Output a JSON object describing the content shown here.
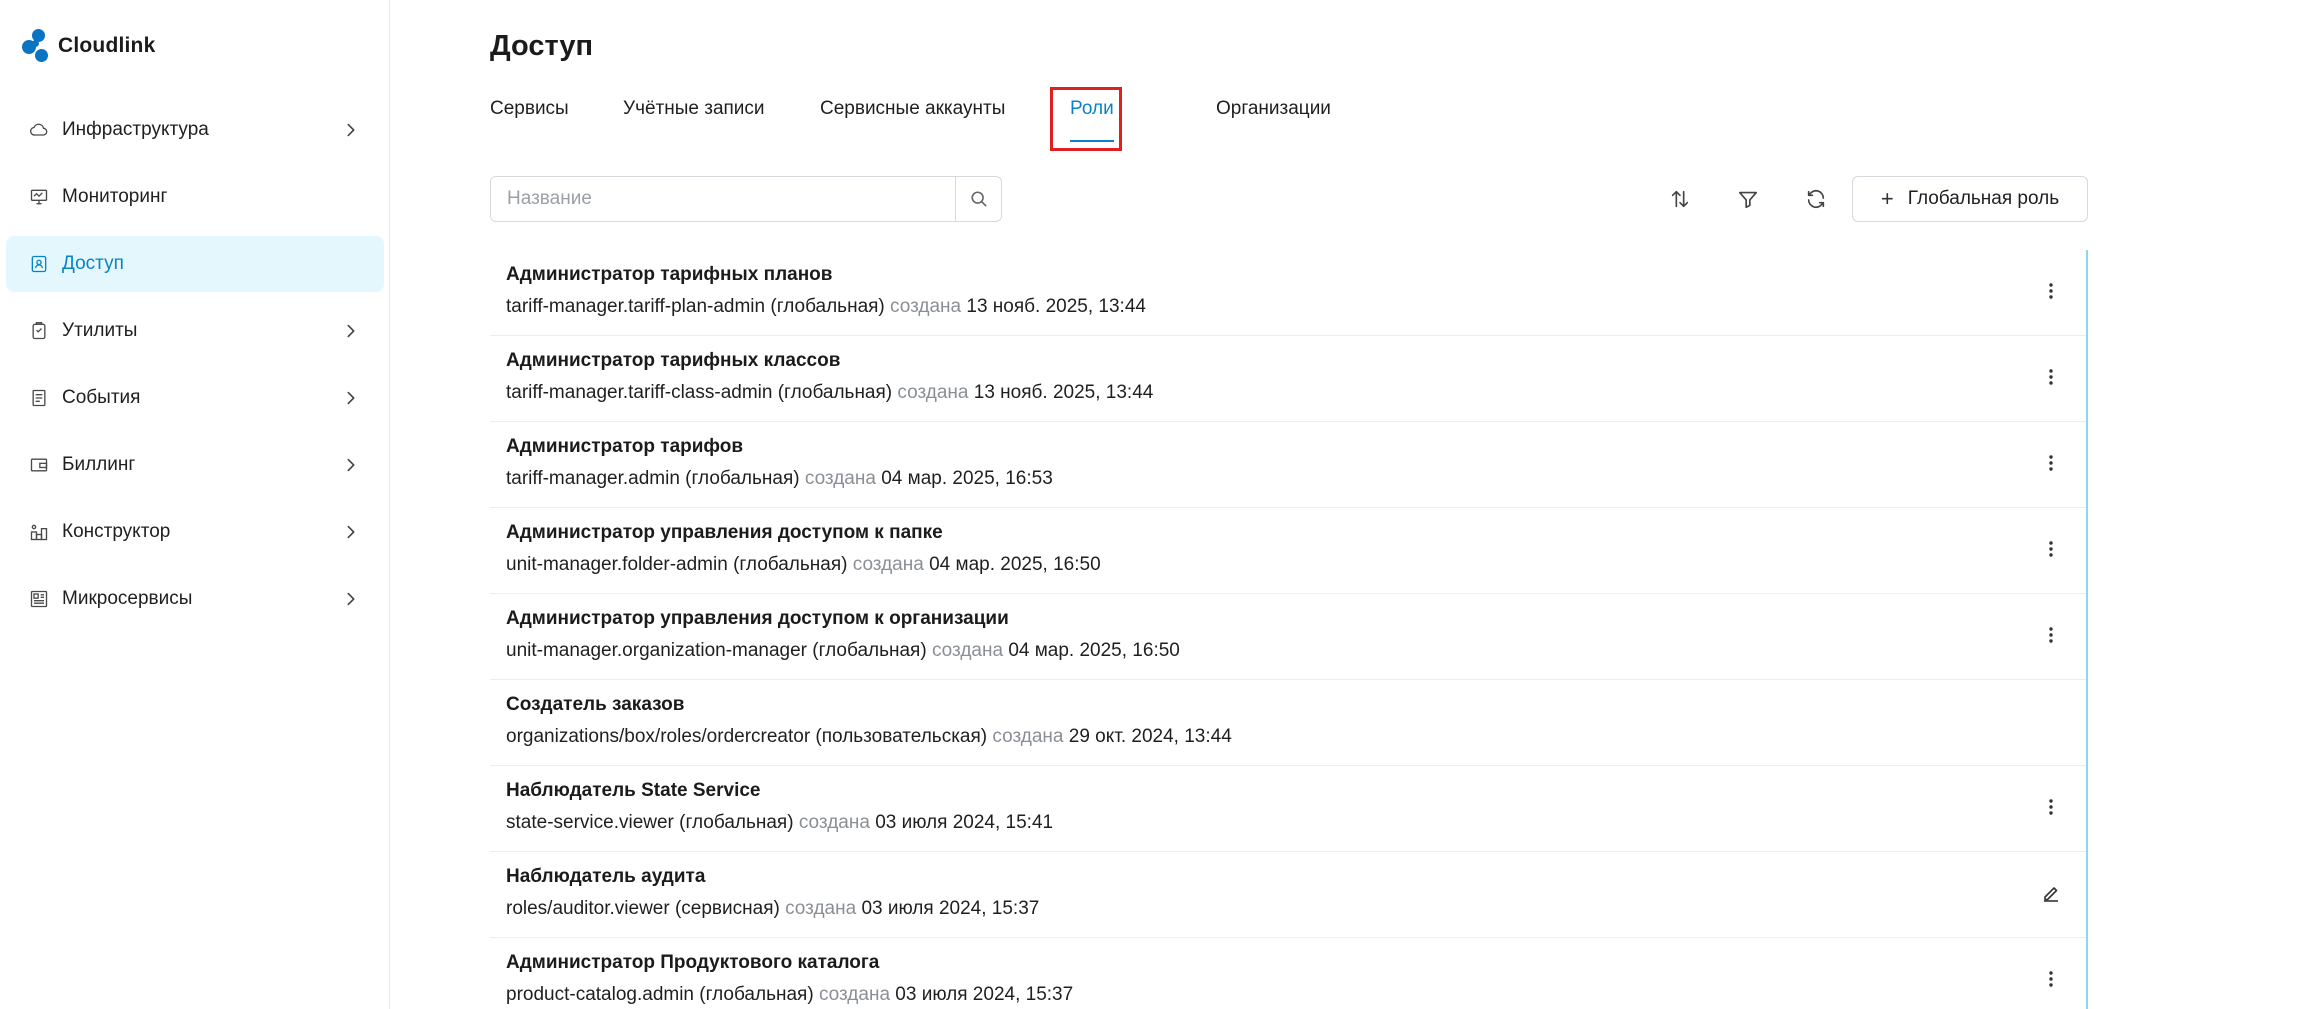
{
  "app": {
    "name": "Cloudlink"
  },
  "sidebar": {
    "items": [
      {
        "label": "Инфраструктура",
        "icon": "cloud-icon",
        "chevron": true,
        "active": false
      },
      {
        "label": "Мониторинг",
        "icon": "monitor-icon",
        "chevron": false,
        "active": false
      },
      {
        "label": "Доступ",
        "icon": "access-icon",
        "chevron": false,
        "active": true
      },
      {
        "label": "Утилиты",
        "icon": "tools-icon",
        "chevron": true,
        "active": false
      },
      {
        "label": "События",
        "icon": "events-icon",
        "chevron": true,
        "active": false
      },
      {
        "label": "Биллинг",
        "icon": "billing-icon",
        "chevron": true,
        "active": false
      },
      {
        "label": "Конструктор",
        "icon": "constructor-icon",
        "chevron": true,
        "active": false
      },
      {
        "label": "Микросервисы",
        "icon": "microservices-icon",
        "chevron": true,
        "active": false
      }
    ]
  },
  "page": {
    "title": "Доступ"
  },
  "tabs": [
    {
      "label": "Сервисы",
      "active": false
    },
    {
      "label": "Учётные записи",
      "active": false
    },
    {
      "label": "Сервисные аккаунты",
      "active": false
    },
    {
      "label": "Роли",
      "active": true
    },
    {
      "label": "Организации",
      "active": false
    }
  ],
  "search": {
    "placeholder": "Название",
    "value": ""
  },
  "toolbar": {
    "global_role_label": "Глобальная роль"
  },
  "created_label": "создана",
  "roles": [
    {
      "title": "Администратор тарифных планов",
      "id": "tariff-manager.tariff-plan-admin (глобальная)",
      "date": "13 нояб. 2025, 13:44",
      "action": "more"
    },
    {
      "title": "Администратор тарифных классов",
      "id": "tariff-manager.tariff-class-admin (глобальная)",
      "date": "13 нояб. 2025, 13:44",
      "action": "more"
    },
    {
      "title": "Администратор тарифов",
      "id": "tariff-manager.admin (глобальная)",
      "date": "04 мар. 2025, 16:53",
      "action": "more"
    },
    {
      "title": "Администратор управления доступом к папке",
      "id": "unit-manager.folder-admin (глобальная)",
      "date": "04 мар. 2025, 16:50",
      "action": "more"
    },
    {
      "title": "Администратор управления доступом к организации",
      "id": "unit-manager.organization-manager (глобальная)",
      "date": "04 мар. 2025, 16:50",
      "action": "more"
    },
    {
      "title": "Создатель заказов",
      "id": "organizations/box/roles/ordercreator (пользовательская)",
      "date": "29 окт. 2024, 13:44",
      "action": "none"
    },
    {
      "title": "Наблюдатель State Service",
      "id": "state-service.viewer (глобальная)",
      "date": "03 июля 2024, 15:41",
      "action": "more"
    },
    {
      "title": "Наблюдатель аудита",
      "id": "roles/auditor.viewer (сервисная)",
      "date": "03 июля 2024, 15:37",
      "action": "edit"
    },
    {
      "title": "Администратор Продуктового каталога",
      "id": "product-catalog.admin (глобальная)",
      "date": "03 июля 2024, 15:37",
      "action": "more"
    }
  ],
  "colors": {
    "accent": "#0a83c6",
    "active_bg": "#e3f7fd",
    "highlight": "#e02020"
  }
}
